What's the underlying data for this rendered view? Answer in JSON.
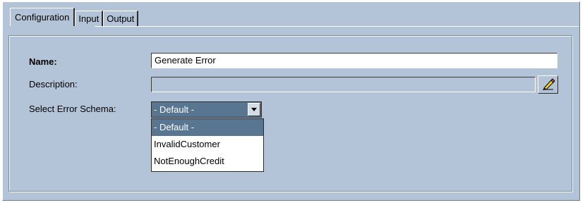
{
  "tabs": [
    {
      "label": "Configuration",
      "active": true
    },
    {
      "label": "Input",
      "active": false
    },
    {
      "label": "Output",
      "active": false
    }
  ],
  "form": {
    "name_label": "Name:",
    "name_value": "Generate Error",
    "description_label": "Description:",
    "description_value": "",
    "schema_label": "Select Error Schema:",
    "schema_selected": "- Default -",
    "schema_options": [
      "- Default -",
      "InvalidCustomer",
      "NotEnoughCredit"
    ],
    "edit_button_icon": "pencil-icon"
  },
  "colors": {
    "panel_background": "#b4c4d8",
    "selection": "#587592"
  }
}
